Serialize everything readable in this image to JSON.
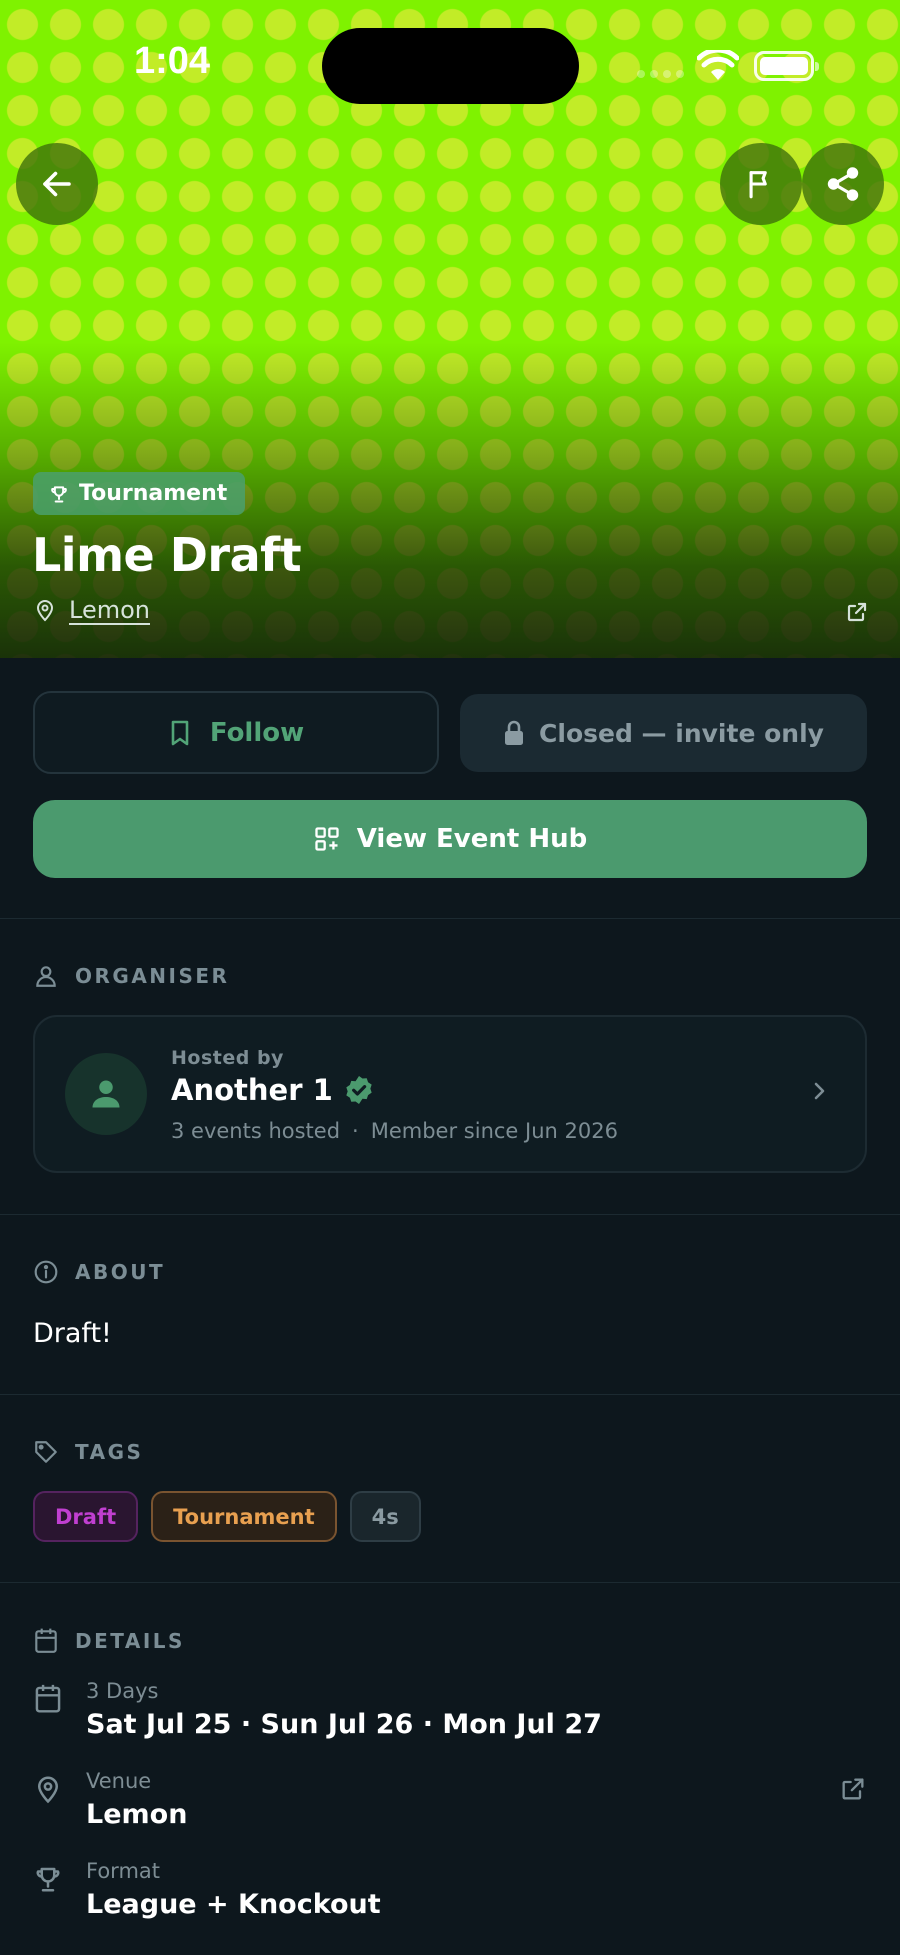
{
  "status_bar": {
    "time": "1:04"
  },
  "event": {
    "type_badge": "Tournament",
    "title": "Lime Draft",
    "location": "Lemon"
  },
  "actions": {
    "follow_label": "Follow",
    "closed_label": "Closed — invite only",
    "hub_label": "View Event Hub"
  },
  "organiser": {
    "heading": "ORGANISER",
    "hosted_by_label": "Hosted by",
    "name": "Another 1",
    "events_hosted": "3 events hosted",
    "separator": "·",
    "member_since": "Member since Jun 2026"
  },
  "about": {
    "heading": "ABOUT",
    "text": "Draft!"
  },
  "tags": {
    "heading": "TAGS",
    "items": [
      "Draft",
      "Tournament",
      "4s"
    ]
  },
  "details": {
    "heading": "DETAILS",
    "dates": {
      "label": "3 Days",
      "value": "Sat Jul 25  ·  Sun Jul 26  ·  Mon Jul 27"
    },
    "venue": {
      "label": "Venue",
      "value": "Lemon"
    },
    "format": {
      "label": "Format",
      "value": "League + Knockout"
    }
  },
  "colors": {
    "accent_green": "#4b9a6e",
    "hero_lime": "#7ff200",
    "background": "#0d171d",
    "tag_draft": "#c03fd0",
    "tag_tournament": "#e8a050"
  }
}
